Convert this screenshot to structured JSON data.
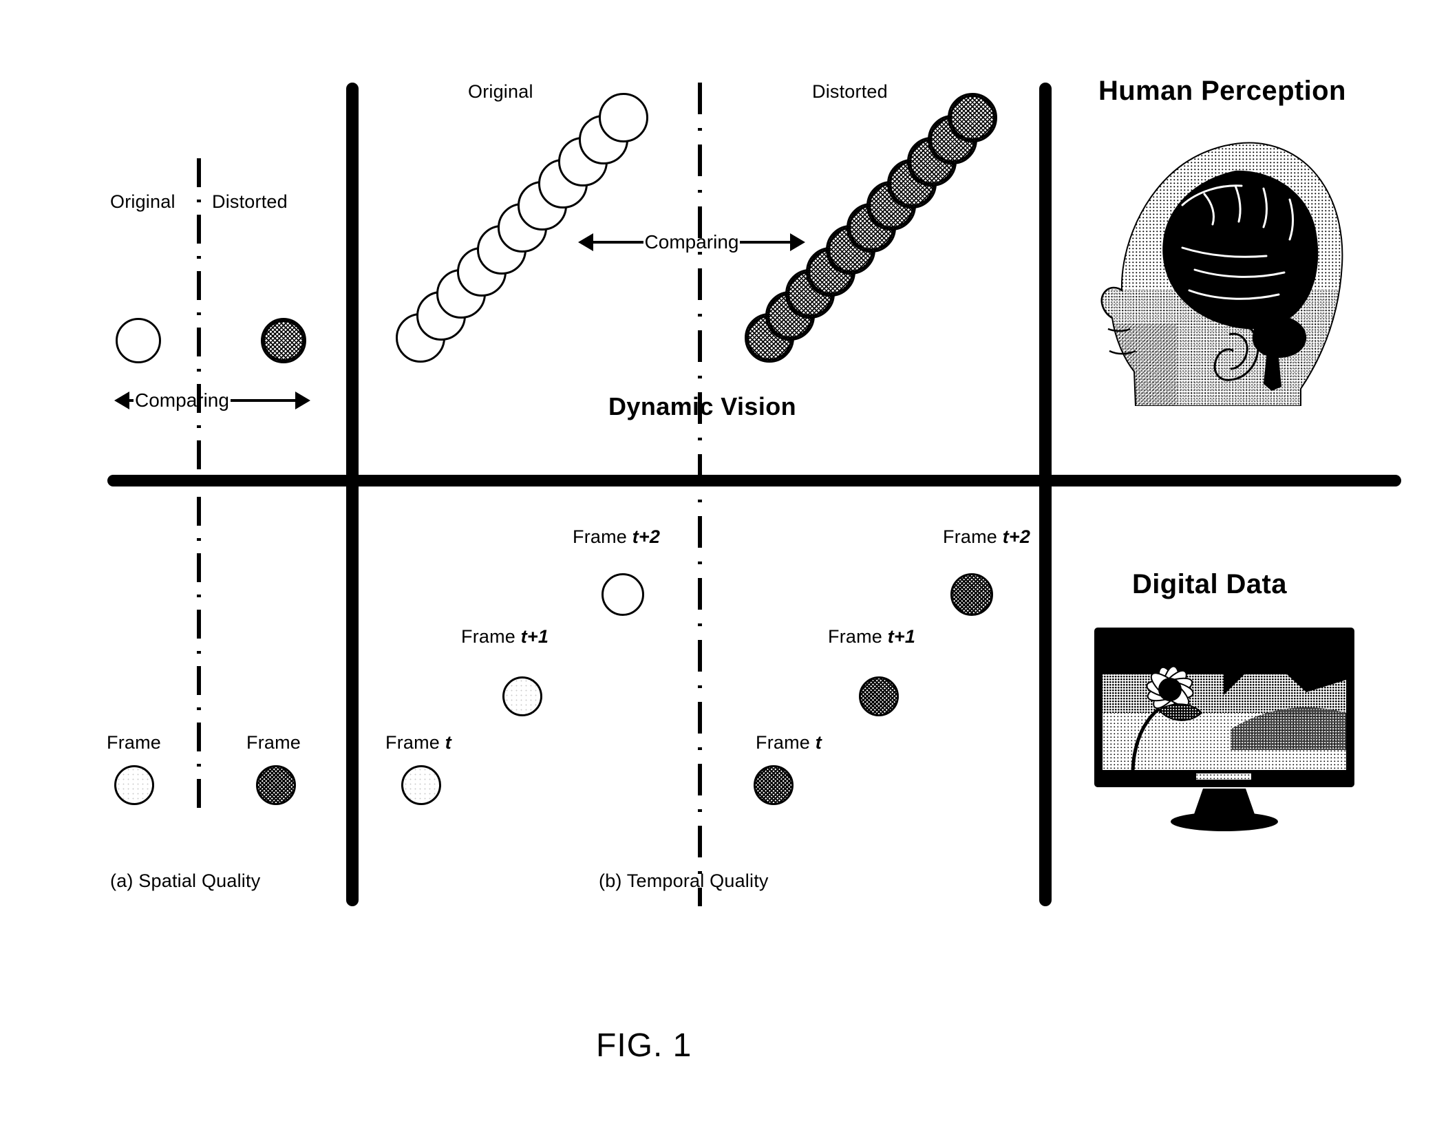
{
  "figure": {
    "number": "FIG. 1",
    "panel_a_caption": "(a) Spatial Quality",
    "panel_b_caption": "(b) Temporal Quality",
    "dynamic_vision_label": "Dynamic Vision"
  },
  "panel_a": {
    "left_label": "Original",
    "right_label": "Distorted",
    "comparing_label": "Comparing",
    "frame_label_left": "Frame",
    "frame_label_right": "Frame"
  },
  "panel_b": {
    "top_left_label": "Original",
    "top_right_label": "Distorted",
    "comparing_label": "Comparing",
    "original_frames": [
      {
        "prefix": "Frame ",
        "suffix": "t"
      },
      {
        "prefix": "Frame ",
        "suffix": "t+1"
      },
      {
        "prefix": "Frame ",
        "suffix": "t+2"
      }
    ],
    "distorted_frames": [
      {
        "prefix": "Frame ",
        "suffix": "t"
      },
      {
        "prefix": "Frame ",
        "suffix": "t+1"
      },
      {
        "prefix": "Frame ",
        "suffix": "t+2"
      }
    ]
  },
  "panel_c": {
    "top_title": "Human Perception",
    "bottom_title": "Digital Data",
    "top_image_name": "human-head-brain-illustration",
    "bottom_image_name": "computer-monitor-flower-image"
  },
  "colors": {
    "ink": "#000000",
    "paper": "#ffffff"
  },
  "chart_data": {
    "type": "diagram",
    "title": "FIG. 1",
    "description": "Patent figure: 2x3 quadrant diagram contrasting spatial vs temporal video quality assessment for human perception vs digital data.",
    "quadrants": [
      {
        "row": "top",
        "column": "a",
        "content": "Single original circle vs single distorted circle with Comparing arrow"
      },
      {
        "row": "top",
        "column": "b",
        "content": "Diagonal chain of 11 original circles vs diagonal chain of 11 distorted circles with Comparing arrow, labeled Dynamic Vision"
      },
      {
        "row": "top",
        "column": "c",
        "content": "Human Perception - head with brain illustration"
      },
      {
        "row": "bottom",
        "column": "a",
        "content": "Frame original circle vs Frame distorted circle"
      },
      {
        "row": "bottom",
        "column": "b",
        "content": "Frame t, Frame t+1, Frame t+2 original circles vs Frame t, Frame t+1, Frame t+2 distorted circles"
      },
      {
        "row": "bottom",
        "column": "c",
        "content": "Digital Data - computer monitor showing flower image"
      }
    ],
    "original_chain_count": 11,
    "distorted_chain_count": 11
  }
}
